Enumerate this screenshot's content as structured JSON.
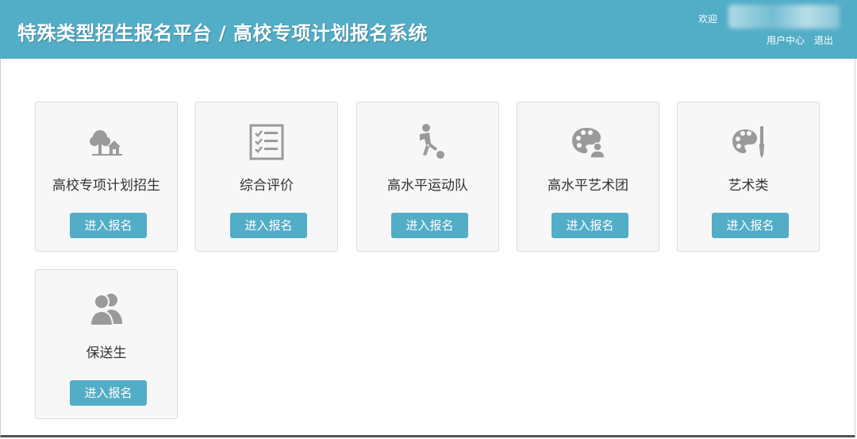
{
  "header": {
    "title": "特殊类型招生报名平台 / 高校专项计划报名系统",
    "welcome": "欢迎",
    "user_center": "用户中心",
    "logout": "退出"
  },
  "cards": [
    {
      "label": "高校专项计划招生",
      "button": "进入报名",
      "icon": "tree-house-icon"
    },
    {
      "label": "综合评价",
      "button": "进入报名",
      "icon": "checklist-icon"
    },
    {
      "label": "高水平运动队",
      "button": "进入报名",
      "icon": "soccer-player-icon"
    },
    {
      "label": "高水平艺术团",
      "button": "进入报名",
      "icon": "palette-person-icon"
    },
    {
      "label": "艺术类",
      "button": "进入报名",
      "icon": "palette-brush-icon"
    },
    {
      "label": "保送生",
      "button": "进入报名",
      "icon": "users-icon"
    }
  ],
  "colors": {
    "header_bg": "#52adc7",
    "button_bg": "#52adc7",
    "card_bg": "#f7f7f7",
    "icon": "#9a9a9a"
  }
}
